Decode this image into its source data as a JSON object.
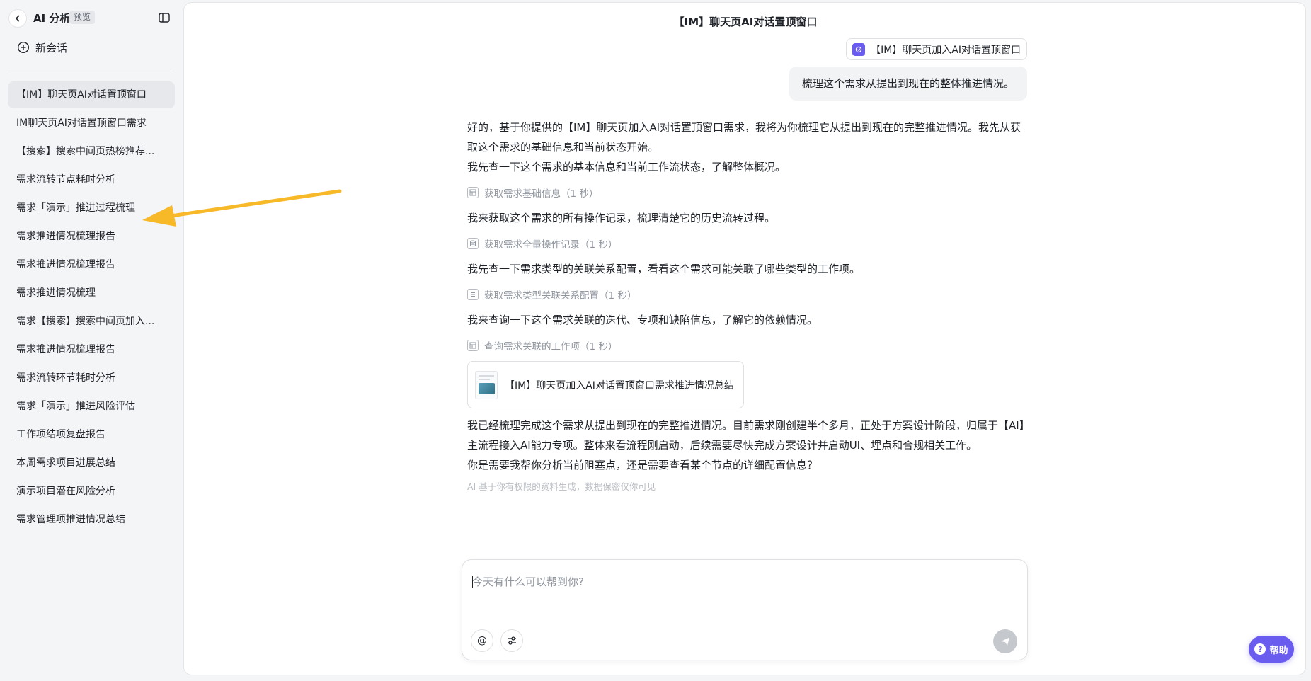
{
  "sidebar": {
    "title": "AI 分析",
    "badge": "预览",
    "new_chat_label": "新会话",
    "history": [
      "【IM】聊天页AI对话置顶窗口",
      "IM聊天页AI对话置顶窗口需求",
      "【搜索】搜索中间页热榜推荐...",
      "需求流转节点耗时分析",
      "需求「演示」推进过程梳理",
      "需求推进情况梳理报告",
      "需求推进情况梳理报告",
      "需求推进情况梳理",
      "需求【搜索】搜索中间页加入...",
      "需求推进情况梳理报告",
      "需求流转环节耗时分析",
      "需求「演示」推进风险评估",
      "工作项结项复盘报告",
      "本周需求项目进展总结",
      "演示项目潜在风险分析",
      "需求管理项推进情况总结"
    ]
  },
  "chat": {
    "title": "【IM】聊天页AI对话置顶窗口",
    "user_tag": "【IM】聊天页加入AI对话置顶窗口",
    "user_message": "梳理这个需求从提出到现在的整体推进情况。",
    "intro_1": "好的，基于你提供的【IM】聊天页加入AI对话置顶窗口需求，我将为你梳理它从提出到现在的完整推进情况。我先从获取这个需求的基础信息和当前状态开始。",
    "intro_2": "我先查一下这个需求的基本信息和当前工作流状态，了解整体概况。",
    "step_1": "获取需求基础信息（1 秒）",
    "para_2": "我来获取这个需求的所有操作记录，梳理清楚它的历史流转过程。",
    "step_2": "获取需求全量操作记录（1 秒）",
    "para_3": "我先查一下需求类型的关联关系配置，看看这个需求可能关联了哪些类型的工作项。",
    "step_3": "获取需求类型关联关系配置（1 秒）",
    "para_4": "我来查询一下这个需求关联的迭代、专项和缺陷信息，了解它的依赖情况。",
    "step_4": "查询需求关联的工作项（1 秒）",
    "doc_card_title": "【IM】聊天页加入AI对话置顶窗口需求推进情况总结",
    "summary_1": "我已经梳理完成这个需求从提出到现在的完整推进情况。目前需求刚创建半个多月，正处于方案设计阶段，归属于【AI】主流程接入AI能力专项。整体来看流程刚启动，后续需要尽快完成方案设计并启动UI、埋点和合规相关工作。",
    "summary_2": "你是需要我帮你分析当前阻塞点，还是需要查看某个节点的详细配置信息？",
    "disclaimer": "AI 基于你有权限的资料生成，数据保密仅你可见"
  },
  "composer": {
    "placeholder": "今天有什么可以帮到你?",
    "mention_label": "@"
  },
  "help": {
    "label": "帮助"
  },
  "colors": {
    "accent": "#6b5cf0",
    "annotation_arrow": "#f7b928"
  }
}
